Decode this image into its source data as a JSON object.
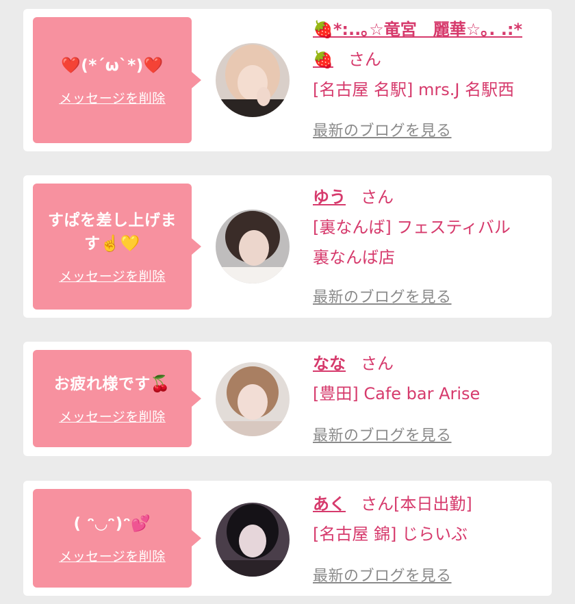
{
  "delete_label": "メッセージを削除",
  "blog_label": "最新のブログを見る",
  "honorific": "さん",
  "colors": {
    "bubble": "#f7919f",
    "accent": "#d63a6c",
    "link_gray": "#8a8a8a",
    "card": "#ffffff",
    "background": "#ebebeb"
  },
  "messages": [
    {
      "message": "❤️(*´ω`*)❤️",
      "name_line1": "🍓*:..｡☆竜宮　麗華☆｡. .:*",
      "name_line2": "🍓",
      "shop": "[名古屋 名駅] mrs.J 名駅西",
      "status": ""
    },
    {
      "message_line1": "すぱを差し上げま",
      "message_line2": "す☝️💛",
      "name": "ゆう",
      "shop_line1": "[裏なんば] フェスティバル",
      "shop_line2": "裏なんば店"
    },
    {
      "message": "お疲れ様です🍒",
      "name": "なな",
      "shop": "[豊田] Cafe bar Arise"
    },
    {
      "message": "( ᵔ◡ᵔ)ᵔ💕",
      "name": "あく",
      "status": "[本日出勤]",
      "shop": "[名古屋 錦] じらいぶ"
    }
  ]
}
